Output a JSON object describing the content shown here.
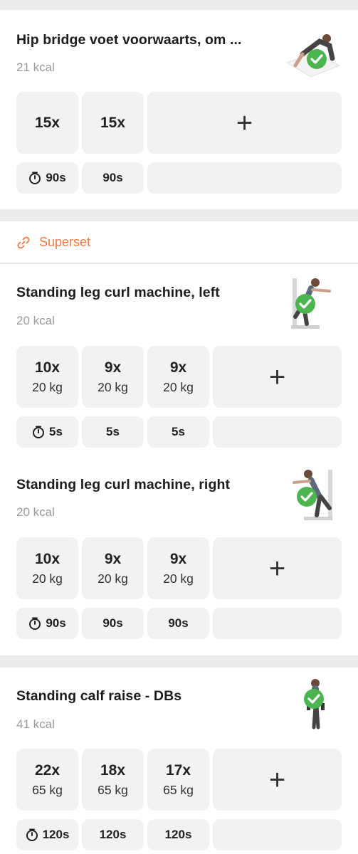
{
  "superset": {
    "label": "Superset",
    "icon": "link-icon"
  },
  "accent_color": "#f07a45",
  "check_color": "#4cb552",
  "exercises": [
    {
      "title": "Hip bridge voet voorwaarts, om ...",
      "kcal": "21 kcal",
      "sets": [
        {
          "reps": "15x",
          "weight": ""
        },
        {
          "reps": "15x",
          "weight": ""
        }
      ],
      "rests": [
        "90s",
        "90s"
      ]
    },
    {
      "title": "Standing leg curl machine, left",
      "kcal": "20 kcal",
      "sets": [
        {
          "reps": "10x",
          "weight": "20 kg"
        },
        {
          "reps": "9x",
          "weight": "20 kg"
        },
        {
          "reps": "9x",
          "weight": "20 kg"
        }
      ],
      "rests": [
        "5s",
        "5s",
        "5s"
      ]
    },
    {
      "title": "Standing leg curl machine, right",
      "kcal": "20 kcal",
      "sets": [
        {
          "reps": "10x",
          "weight": "20 kg"
        },
        {
          "reps": "9x",
          "weight": "20 kg"
        },
        {
          "reps": "9x",
          "weight": "20 kg"
        }
      ],
      "rests": [
        "90s",
        "90s",
        "90s"
      ]
    },
    {
      "title": "Standing calf raise - DBs",
      "kcal": "41 kcal",
      "sets": [
        {
          "reps": "22x",
          "weight": "65 kg"
        },
        {
          "reps": "18x",
          "weight": "65 kg"
        },
        {
          "reps": "17x",
          "weight": "65 kg"
        }
      ],
      "rests": [
        "120s",
        "120s",
        "120s"
      ]
    }
  ],
  "add_set_label": "+"
}
